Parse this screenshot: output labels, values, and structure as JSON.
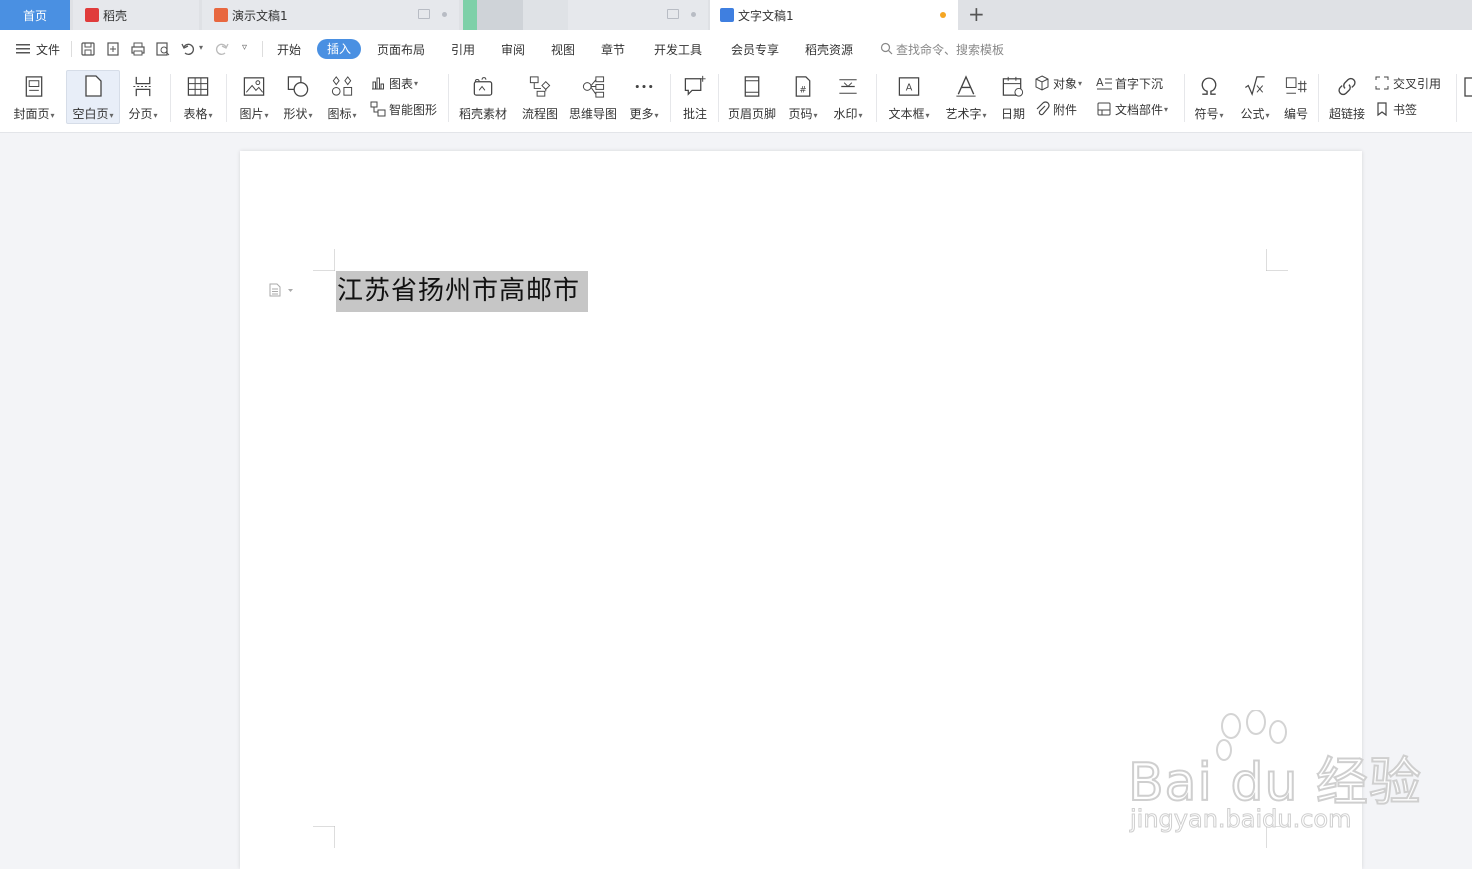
{
  "tabs": {
    "home": "首页",
    "daoke": "稻壳",
    "ppt": "演示文稿1",
    "doc": "文字文稿1",
    "add": "+"
  },
  "menu": {
    "file": "文件",
    "items": [
      "开始",
      "插入",
      "页面布局",
      "引用",
      "审阅",
      "视图",
      "章节",
      "开发工具",
      "会员专享",
      "稻壳资源"
    ],
    "active": "插入",
    "search": "查找命令、搜索模板"
  },
  "ribbon": {
    "cover": "封面页",
    "blank": "空白页",
    "pagebreak": "分页",
    "table": "表格",
    "picture": "图片",
    "shape": "形状",
    "iconlib": "图标",
    "chart": "图表",
    "smartart": "智能图形",
    "material": "稻壳素材",
    "flowchart": "流程图",
    "mindmap": "思维导图",
    "more": "更多",
    "comment": "批注",
    "headerfooter": "页眉页脚",
    "pagenum": "页码",
    "watermark": "水印",
    "textbox": "文本框",
    "wordart": "艺术字",
    "date": "日期",
    "object": "对象",
    "attachment": "附件",
    "dropcap": "首字下沉",
    "docparts": "文档部件",
    "symbol": "符号",
    "formula": "公式",
    "numbering": "编号",
    "hyperlink": "超链接",
    "crossref": "交叉引用",
    "bookmark": "书签"
  },
  "document": {
    "selected_text": "江苏省扬州市高邮市"
  },
  "watermark": {
    "brand": "Bai du 经验",
    "url": "jingyan.baidu.com"
  },
  "colors": {
    "accent": "#4a90e2",
    "unsaved": "#f5a623",
    "selection": "#c6c6c6"
  }
}
